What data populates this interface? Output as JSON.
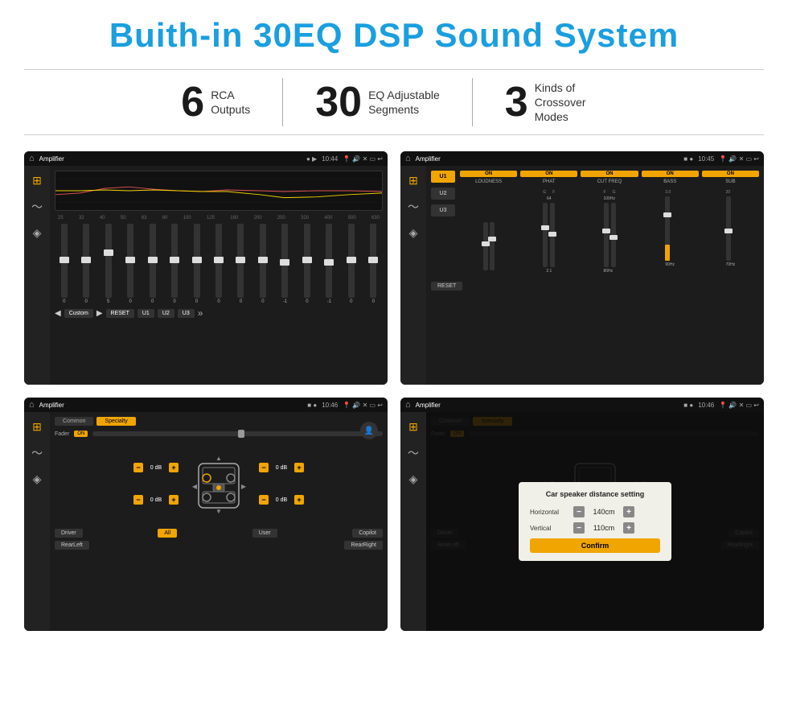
{
  "page": {
    "title": "Buith-in 30EQ DSP Sound System",
    "stats": [
      {
        "number": "6",
        "label": "RCA\nOutputs"
      },
      {
        "number": "30",
        "label": "EQ Adjustable\nSegments"
      },
      {
        "number": "3",
        "label": "Kinds of\nCrossover Modes"
      }
    ]
  },
  "screens": {
    "eq_screen": {
      "status_title": "Amplifier",
      "time": "10:44",
      "freq_labels": [
        "25",
        "32",
        "40",
        "50",
        "63",
        "80",
        "100",
        "125",
        "160",
        "200",
        "250",
        "320",
        "400",
        "500",
        "630"
      ],
      "preset_label": "Custom",
      "buttons": [
        "RESET",
        "U1",
        "U2",
        "U3"
      ]
    },
    "amp_screen": {
      "status_title": "Amplifier",
      "time": "10:45",
      "presets": [
        "U1",
        "U2",
        "U3"
      ],
      "channels": [
        {
          "on": true,
          "label": "LOUDNESS"
        },
        {
          "on": true,
          "label": "PHAT"
        },
        {
          "on": true,
          "label": "CUT FREQ"
        },
        {
          "on": true,
          "label": "BASS"
        },
        {
          "on": true,
          "label": "SUB"
        }
      ],
      "reset_label": "RESET"
    },
    "balance_screen": {
      "status_title": "Amplifier",
      "time": "10:46",
      "tabs": [
        "Common",
        "Specialty"
      ],
      "fader_label": "Fader",
      "fader_on": "ON",
      "db_values": [
        "0 dB",
        "0 dB",
        "0 dB",
        "0 dB"
      ],
      "buttons": [
        "Driver",
        "RearLeft",
        "All",
        "User",
        "RearRight",
        "Copilot"
      ]
    },
    "dialog_screen": {
      "status_title": "Amplifier",
      "time": "10:46",
      "dialog_title": "Car speaker distance setting",
      "horizontal_label": "Horizontal",
      "horizontal_value": "140cm",
      "vertical_label": "Vertical",
      "vertical_value": "110cm",
      "confirm_label": "Confirm"
    }
  }
}
